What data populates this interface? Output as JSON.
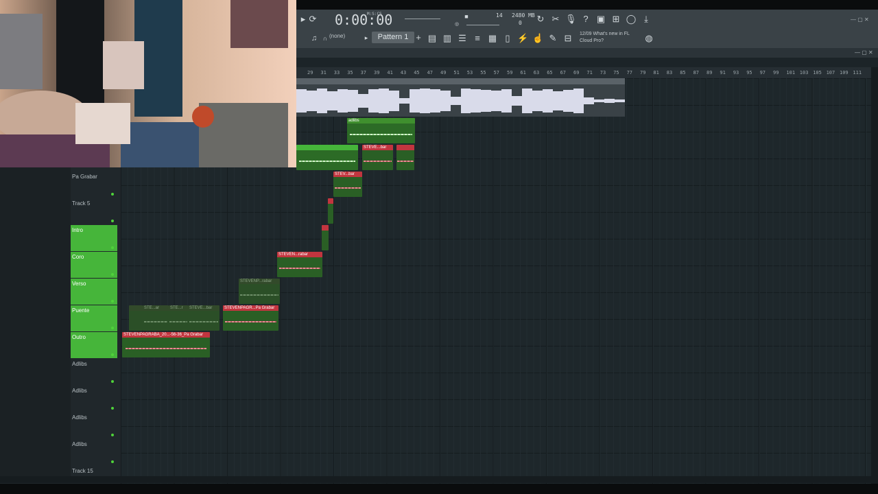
{
  "transport": {
    "time": "0:00:00",
    "time_unit": "M:S:CS",
    "tempo_cpu": "14",
    "memory": "2480 MB",
    "voices": "0"
  },
  "toolbar": {
    "pattern_label": "Pattern 1",
    "channel_select": "(none)",
    "news_text": "12/09  What's new in FL Cloud Pro?"
  },
  "ruler": {
    "bars": [
      "29",
      "31",
      "33",
      "35",
      "37",
      "39",
      "41",
      "43",
      "45",
      "47",
      "49",
      "51",
      "53",
      "55",
      "57",
      "59",
      "61",
      "63",
      "65",
      "67",
      "69",
      "71",
      "73",
      "75",
      "77",
      "79",
      "81",
      "83",
      "85",
      "87",
      "89",
      "91",
      "93",
      "95",
      "97",
      "99",
      "101",
      "103",
      "105",
      "107",
      "109",
      "111"
    ]
  },
  "tracks": [
    {
      "name": "Pa Grabar",
      "highlight": false
    },
    {
      "name": "Track 5",
      "highlight": false
    },
    {
      "name": "Intro",
      "highlight": true
    },
    {
      "name": "Coro",
      "highlight": true
    },
    {
      "name": "Verso",
      "highlight": true
    },
    {
      "name": "Puente",
      "highlight": true
    },
    {
      "name": "Outro",
      "highlight": true
    },
    {
      "name": "Adlibs",
      "highlight": false
    },
    {
      "name": "Adlibs",
      "highlight": false
    },
    {
      "name": "Adlibs",
      "highlight": false
    },
    {
      "name": "Adlibs",
      "highlight": false
    },
    {
      "name": "Track 15",
      "highlight": false
    }
  ],
  "clips": {
    "adlibs_top": "adlibs",
    "steve_bar_1": "STEVE...bar",
    "steve_bar_small": "",
    "stev_bar": "STEV...bar",
    "steven_rabar": "STEVEN...rabar",
    "stevenp_rabar_dim": "STEVENP...rabar",
    "puente_dim_1": "STE...ar",
    "puente_dim_2": "STE...r",
    "puente_dim_3": "STEVE...bar",
    "stevenpagr": "STEVENPAGR...Pa Grabar",
    "outro_clip": "STEVENPAGRABA_20...-56-36_Pa Grabar"
  },
  "colors": {
    "accent_green": "#46b53a",
    "clip_red": "#c2353f",
    "clip_green": "#2c6b26",
    "background": "#1b2226"
  }
}
